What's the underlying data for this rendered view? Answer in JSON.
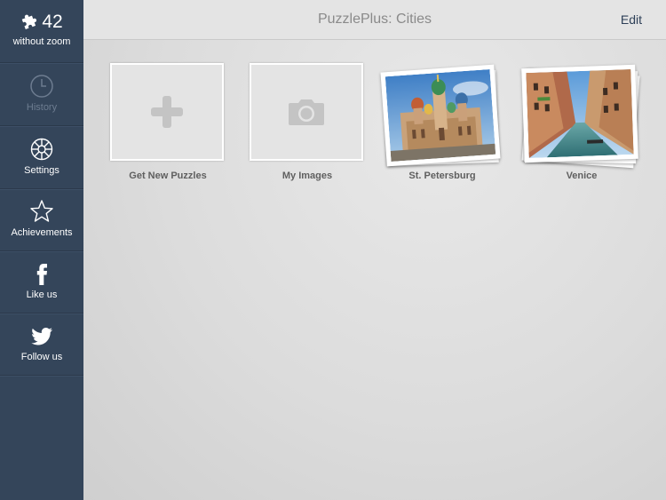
{
  "sidebar": {
    "count": {
      "value": "42",
      "label": "without zoom",
      "icon": "puzzle-piece-icon"
    },
    "items": [
      {
        "label": "History",
        "icon": "clock-icon",
        "enabled": false
      },
      {
        "label": "Settings",
        "icon": "gear-icon",
        "enabled": true
      },
      {
        "label": "Achievements",
        "icon": "star-icon",
        "enabled": true
      },
      {
        "label": "Like us",
        "icon": "facebook-icon",
        "enabled": true
      },
      {
        "label": "Follow us",
        "icon": "twitter-icon",
        "enabled": true
      }
    ]
  },
  "header": {
    "title": "PuzzlePlus: Cities",
    "edit_label": "Edit"
  },
  "tiles": [
    {
      "label": "Get New Puzzles",
      "icon": "plus-icon"
    },
    {
      "label": "My Images",
      "icon": "camera-icon"
    },
    {
      "label": "St. Petersburg",
      "icon": "cathedral-photo"
    },
    {
      "label": "Venice",
      "icon": "canal-photo"
    }
  ],
  "colors": {
    "sidebar_bg": "#34455a",
    "header_text": "#8a8a8a",
    "edit_text": "#2e4058",
    "caption_text": "#5f5f5f"
  }
}
